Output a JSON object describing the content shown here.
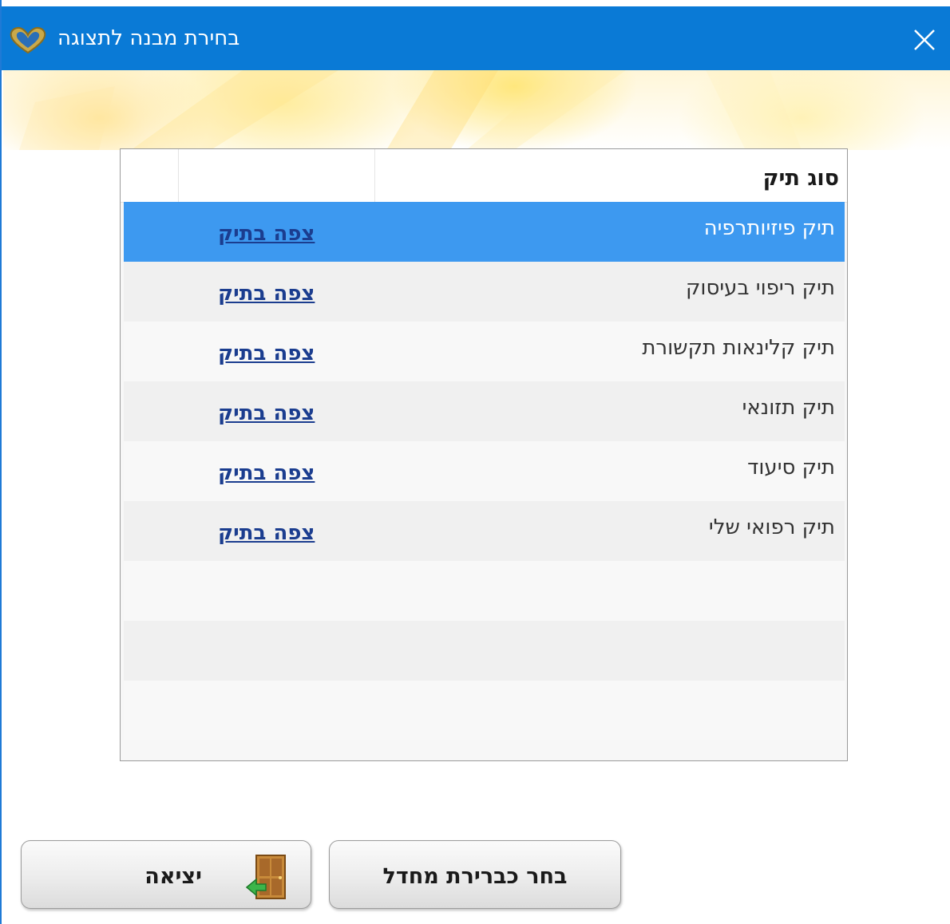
{
  "window": {
    "title": "בחירת מבנה לתצוגה"
  },
  "grid": {
    "header": {
      "type_column": "סוג תיק"
    },
    "rows": [
      {
        "name": "תיק פיזיותרפיה",
        "link": "צפה בתיק",
        "selected": true
      },
      {
        "name": "תיק ריפוי בעיסוק",
        "link": "צפה בתיק",
        "selected": false
      },
      {
        "name": "תיק קלינאות תקשורת",
        "link": "צפה בתיק",
        "selected": false
      },
      {
        "name": "תיק תזונאי",
        "link": "צפה בתיק",
        "selected": false
      },
      {
        "name": "תיק סיעוד",
        "link": "צפה בתיק",
        "selected": false
      },
      {
        "name": "תיק רפואי שלי",
        "link": "צפה בתיק",
        "selected": false
      }
    ]
  },
  "buttons": {
    "exit_label": "יציאה",
    "default_label": "בחר כברירת מחדל"
  },
  "colors": {
    "titlebar": "#0a7ad6",
    "selected_row": "#3d99f0",
    "link": "#1b3d8f"
  },
  "icons": {
    "title": "heart-logo-icon",
    "close": "close-icon",
    "exit": "door-exit-icon"
  }
}
